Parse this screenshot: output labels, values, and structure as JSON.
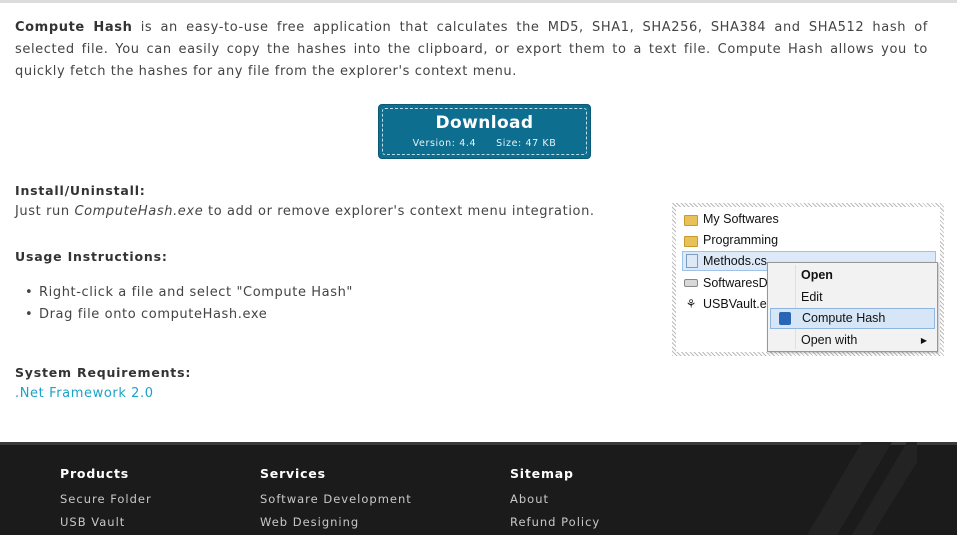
{
  "intro": {
    "app_name": "Compute Hash",
    "text": " is an easy-to-use free application that calculates the MD5, SHA1, SHA256, SHA384 and SHA512 hash of selected file. You can easily copy the hashes into the clipboard, or export them to a text file. Compute Hash allows you to quickly fetch the hashes for any file from the explorer's context menu."
  },
  "download": {
    "label": "Download",
    "version": "Version: 4.4",
    "size": "Size: 47 KB"
  },
  "install": {
    "heading": "Install/Uninstall:",
    "text_before": "Just run ",
    "exe": "ComputeHash.exe",
    "text_after": " to add or remove explorer's context menu integration."
  },
  "usage": {
    "heading": "Usage Instructions:",
    "items": [
      "Right-click a file and select \"Compute Hash\"",
      "Drag file onto computeHash.exe"
    ]
  },
  "requirements": {
    "heading": "System Requirements:",
    "link": ".Net Framework 2.0"
  },
  "explorer": {
    "rows": [
      "My Softwares",
      "Programming",
      "Methods.cs",
      "SoftwaresDi",
      "USBVault.ex"
    ],
    "menu": [
      "Open",
      "Edit",
      "Compute Hash",
      "Open with"
    ]
  },
  "footer": {
    "products": {
      "title": "Products",
      "links": [
        "Secure Folder",
        "USB Vault"
      ]
    },
    "services": {
      "title": "Services",
      "links": [
        "Software Development",
        "Web Designing"
      ]
    },
    "sitemap": {
      "title": "Sitemap",
      "links": [
        "About",
        "Refund Policy"
      ]
    }
  }
}
